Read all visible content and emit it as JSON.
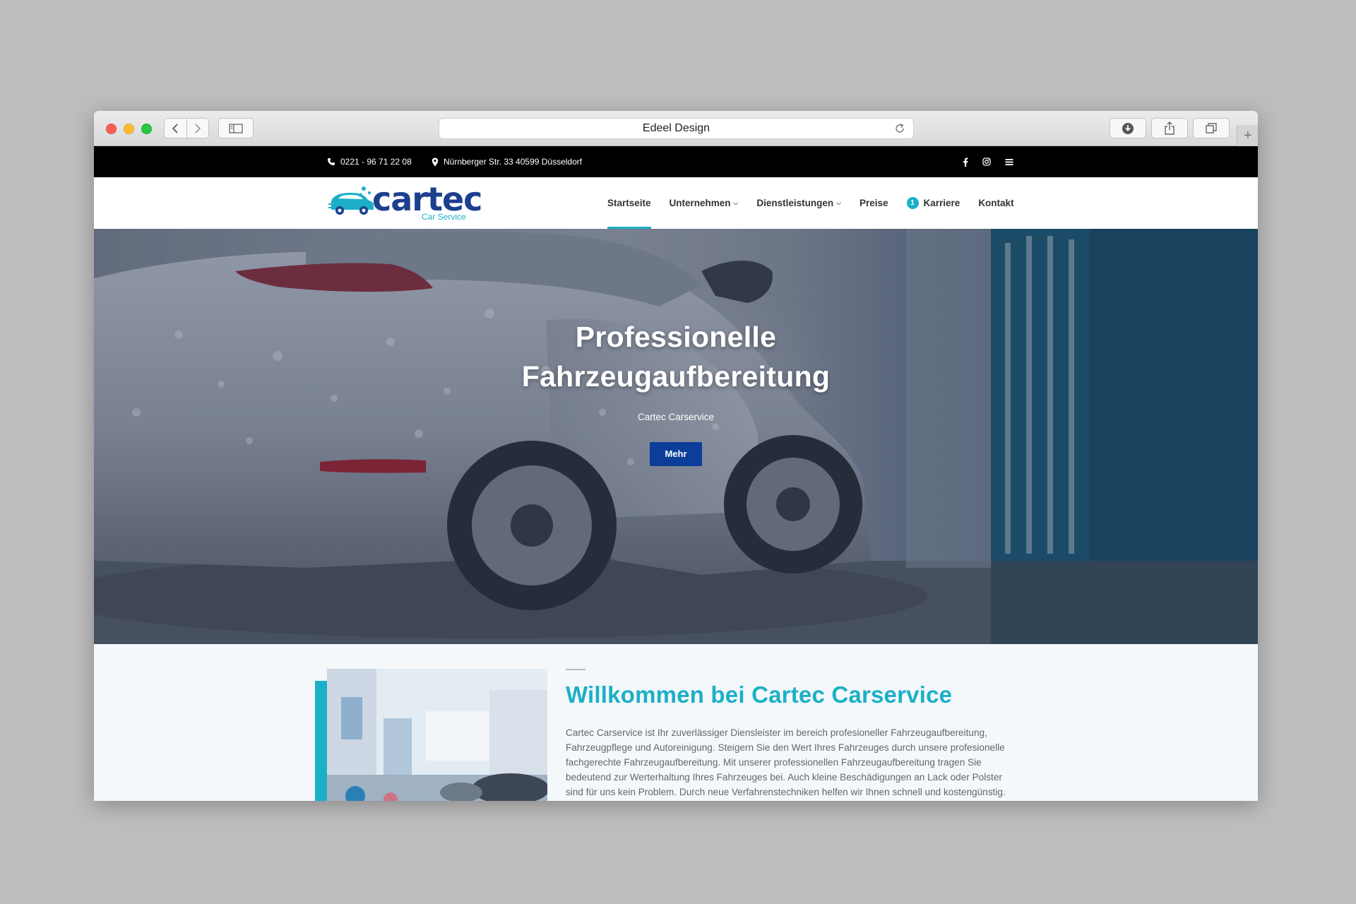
{
  "browser": {
    "url_text": "Edeel Design"
  },
  "topbar": {
    "phone": "0221 - 96 71 22 08",
    "address": "Nürnberger Str. 33 40599 Düsseldorf",
    "social": [
      "facebook-icon",
      "instagram-icon",
      "menu-icon"
    ]
  },
  "logo": {
    "word": "cartec",
    "sub": "Car Service"
  },
  "nav": {
    "items": [
      {
        "label": "Startseite",
        "active": true
      },
      {
        "label": "Unternehmen",
        "dropdown": true
      },
      {
        "label": "Dienstleistungen",
        "dropdown": true
      },
      {
        "label": "Preise"
      },
      {
        "label": "Karriere",
        "badge": "1"
      },
      {
        "label": "Kontakt"
      }
    ]
  },
  "hero": {
    "title_line1": "Professionelle",
    "title_line2": "Fahrzeugaufbereitung",
    "subtitle": "Cartec Carservice",
    "button": "Mehr"
  },
  "welcome": {
    "title": "Willkommen bei Cartec Carservice",
    "body": "Cartec Carservice ist Ihr zuverlässiger Diensleister im bereich profesioneller Fahrzeugaufbereitung, Fahrzeugpflege und Autoreinigung. Steigern Sie den Wert Ihres Fahrzeuges durch unsere profesionelle fachgerechte Fahrzeugaufbereitung. Mit unserer professionellen Fahrzeugaufbereitung tragen Sie bedeutend zur Werterhaltung Ihres Fahrzeuges bei. Auch kleine Beschädigungen an Lack oder Polster sind für uns kein Problem. Durch neue Verfahrenstechniken helfen wir Ihnen schnell und kostengünstig. Setzen Sie sich"
  },
  "colors": {
    "accent": "#1bb0c7",
    "brand_dark": "#1c3f8e",
    "button": "#0b3d99",
    "topbar": "#000000"
  }
}
